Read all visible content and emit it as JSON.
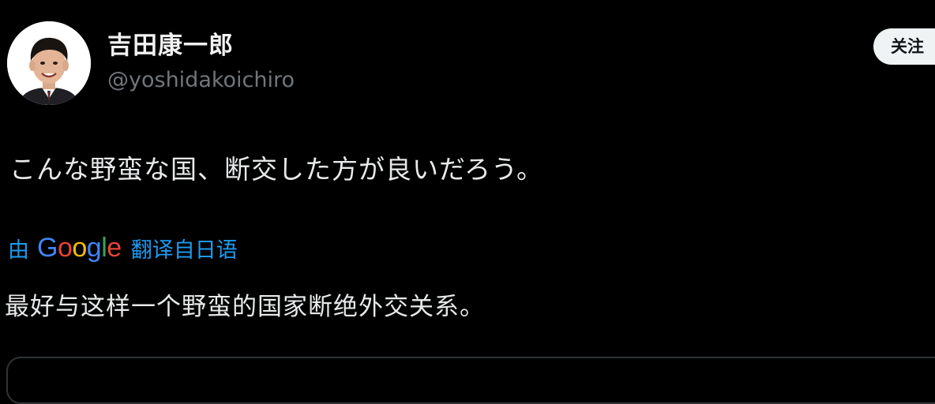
{
  "author": {
    "display_name": "吉田康一郎",
    "handle": "@yoshidakoichiro"
  },
  "follow_button": {
    "label": "关注"
  },
  "tweet": {
    "text": "こんな野蛮な国、断交した方が良いだろう。"
  },
  "translation": {
    "by_label": "由",
    "google_letters": [
      "G",
      "o",
      "o",
      "g",
      "l",
      "e"
    ],
    "suffix_label": "翻译自日语",
    "translated_text": "最好与这样一个野蛮的国家断绝外交关系。"
  },
  "colors": {
    "background": "#000000",
    "primary_text": "#e7e9ea",
    "secondary_text": "#71767b",
    "link": "#1d9bf0",
    "button_bg": "#eff3f4"
  }
}
